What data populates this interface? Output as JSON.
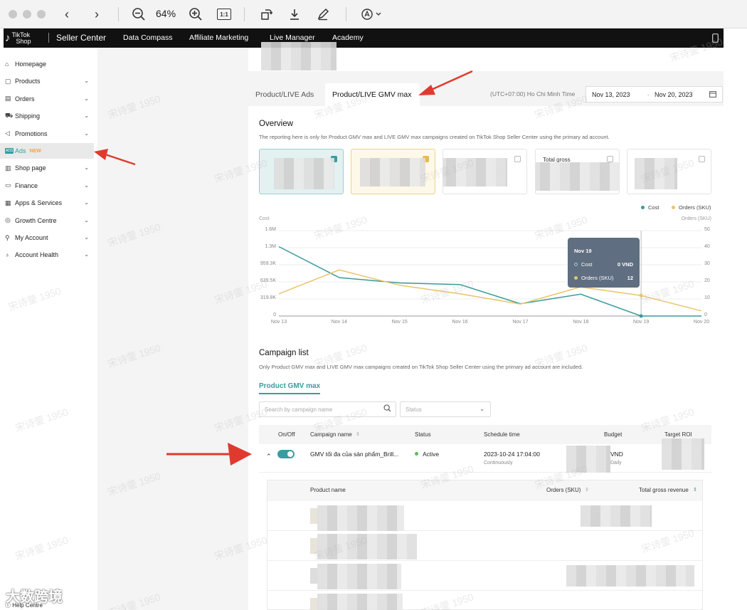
{
  "viewer": {
    "zoom": "64%",
    "actual_size": "1:1"
  },
  "topbar": {
    "brand_top": "TikTok",
    "brand_bottom": "Shop",
    "title": "Seller Center",
    "nav": [
      "Data Compass",
      "Affiliate Marketing",
      "Live Manager",
      "Academy"
    ]
  },
  "sidebar": {
    "items": [
      {
        "label": "Homepage",
        "icon": "home-icon",
        "chevron": false
      },
      {
        "label": "Products",
        "icon": "box-icon",
        "chevron": true
      },
      {
        "label": "Orders",
        "icon": "document-icon",
        "chevron": true
      },
      {
        "label": "Shipping",
        "icon": "truck-icon",
        "chevron": true
      },
      {
        "label": "Promotions",
        "icon": "megaphone-icon",
        "chevron": true
      },
      {
        "label": "Ads",
        "icon": "ads-icon",
        "chevron": false,
        "badge": "NEW",
        "active": true
      },
      {
        "label": "Shop page",
        "icon": "shop-icon",
        "chevron": true
      },
      {
        "label": "Finance",
        "icon": "wallet-icon",
        "chevron": true
      },
      {
        "label": "Apps & Services",
        "icon": "apps-icon",
        "chevron": true
      },
      {
        "label": "Growth Centre",
        "icon": "medal-icon",
        "chevron": true
      },
      {
        "label": "My Account",
        "icon": "person-icon",
        "chevron": true
      },
      {
        "label": "Account Health",
        "icon": "trophy-icon",
        "chevron": true
      }
    ],
    "help": "Help Centre",
    "ads_icon_text": "ADS"
  },
  "tabs": {
    "inactive": "Product/LIVE Ads",
    "active": "Product/LIVE GMV max"
  },
  "timezone": "(UTC+07:00) Ho Chi Minh Time",
  "date_range": {
    "start": "Nov 13, 2023",
    "sep": "-",
    "end": "Nov 20, 2023"
  },
  "overview": {
    "title": "Overview",
    "subtitle": "The reporting here is only for Product GMV max and LIVE GMV max campaigns created on TikTok Shop Seller Center using the primary ad account.",
    "metric_label_4": "Total gross"
  },
  "chart_data": {
    "type": "line",
    "x": [
      "Nov 13",
      "Nov 14",
      "Nov 15",
      "Nov 16",
      "Nov 17",
      "Nov 18",
      "Nov 19",
      "Nov 20"
    ],
    "series": [
      {
        "name": "Cost",
        "color": "#3a9a9a",
        "axis": "left",
        "values": [
          1300000,
          720000,
          620000,
          590000,
          230000,
          410000,
          0,
          0
        ]
      },
      {
        "name": "Orders (SKU)",
        "color": "#e9c46a",
        "axis": "right",
        "values": [
          13,
          27,
          18,
          13,
          7,
          17,
          12,
          3
        ]
      }
    ],
    "ylabel_left": "Cost",
    "ylabel_right": "Orders (SKU)",
    "yticks_left": [
      "1.6M",
      "1.3M",
      "959.3K",
      "639.5K",
      "319.8K",
      "0"
    ],
    "yticks_right": [
      "50",
      "40",
      "30",
      "20",
      "10",
      "0"
    ],
    "ylim_left": [
      0,
      1600000
    ],
    "ylim_right": [
      0,
      50
    ],
    "legend_position": "top-right"
  },
  "tooltip": {
    "title": "Nov 19",
    "rows": [
      {
        "label": "Cost",
        "value": "0 VND",
        "color": "#3a9a9a"
      },
      {
        "label": "Orders (SKU)",
        "value": "12",
        "color": "#e9c46a"
      }
    ]
  },
  "campaigns": {
    "title": "Campaign list",
    "subtitle": "Only Product GMV max and LIVE GMV max campaigns created on TikTok Shop Seller Center using the primary ad account are included.",
    "subtab": "Product GMV max",
    "search_placeholder": "Search by campaign name",
    "status_placeholder": "Status",
    "columns": [
      "On/Off",
      "Campaign name",
      "Status",
      "Schedule time",
      "Budget",
      "Target ROI"
    ],
    "row": {
      "name": "GMV tối đa của sản phẩm_Brill...",
      "status": "Active",
      "schedule": "2023-10-24 17:04:00",
      "schedule_sub": "Continuously",
      "budget": "VND",
      "budget_sub": "Daily"
    },
    "product_columns": [
      "Product name",
      "Orders (SKU)",
      "Total gross revenue"
    ]
  },
  "watermark": "宋诗蓥 1950",
  "corner_watermark": "大数跨境"
}
